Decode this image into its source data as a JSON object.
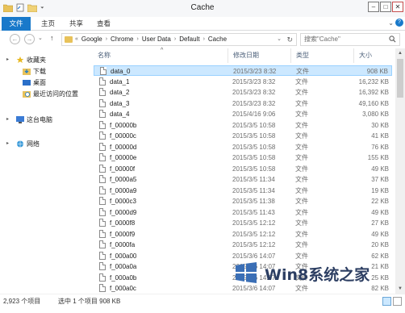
{
  "window": {
    "title": "Cache"
  },
  "ribbon": {
    "tabs": [
      "文件",
      "主页",
      "共享",
      "查看"
    ]
  },
  "nav": {
    "breadcrumb": [
      "Google",
      "Chrome",
      "User Data",
      "Default",
      "Cache"
    ],
    "search_placeholder": "搜索\"Cache\""
  },
  "sidebar": {
    "items": [
      {
        "label": "收藏夹",
        "icon": "favorites-star-icon"
      },
      {
        "label": "下载",
        "icon": "downloads-folder-icon"
      },
      {
        "label": "桌面",
        "icon": "desktop-icon"
      },
      {
        "label": "最近访问的位置",
        "icon": "recent-places-icon"
      },
      {
        "label": "这台电脑",
        "icon": "this-pc-icon"
      },
      {
        "label": "网络",
        "icon": "network-icon"
      }
    ]
  },
  "columns": {
    "name": "名称",
    "date": "修改日期",
    "type": "类型",
    "size": "大小"
  },
  "files": [
    {
      "name": "data_0",
      "date": "2015/3/23 8:32",
      "type": "文件",
      "size": "908 KB",
      "selected": true
    },
    {
      "name": "data_1",
      "date": "2015/3/23 8:32",
      "type": "文件",
      "size": "16,232 KB"
    },
    {
      "name": "data_2",
      "date": "2015/3/23 8:32",
      "type": "文件",
      "size": "16,392 KB"
    },
    {
      "name": "data_3",
      "date": "2015/3/23 8:32",
      "type": "文件",
      "size": "49,160 KB"
    },
    {
      "name": "data_4",
      "date": "2015/4/16 9:06",
      "type": "文件",
      "size": "3,080 KB"
    },
    {
      "name": "f_00000b",
      "date": "2015/3/5 10:58",
      "type": "文件",
      "size": "30 KB"
    },
    {
      "name": "f_00000c",
      "date": "2015/3/5 10:58",
      "type": "文件",
      "size": "41 KB"
    },
    {
      "name": "f_00000d",
      "date": "2015/3/5 10:58",
      "type": "文件",
      "size": "76 KB"
    },
    {
      "name": "f_00000e",
      "date": "2015/3/5 10:58",
      "type": "文件",
      "size": "155 KB"
    },
    {
      "name": "f_00000f",
      "date": "2015/3/5 10:58",
      "type": "文件",
      "size": "49 KB"
    },
    {
      "name": "f_0000a5",
      "date": "2015/3/5 11:34",
      "type": "文件",
      "size": "37 KB"
    },
    {
      "name": "f_0000a9",
      "date": "2015/3/5 11:34",
      "type": "文件",
      "size": "19 KB"
    },
    {
      "name": "f_0000c3",
      "date": "2015/3/5 11:38",
      "type": "文件",
      "size": "22 KB"
    },
    {
      "name": "f_0000d9",
      "date": "2015/3/5 11:43",
      "type": "文件",
      "size": "49 KB"
    },
    {
      "name": "f_0000f8",
      "date": "2015/3/5 12:12",
      "type": "文件",
      "size": "27 KB"
    },
    {
      "name": "f_0000f9",
      "date": "2015/3/5 12:12",
      "type": "文件",
      "size": "49 KB"
    },
    {
      "name": "f_0000fa",
      "date": "2015/3/5 12:12",
      "type": "文件",
      "size": "20 KB"
    },
    {
      "name": "f_000a00",
      "date": "2015/3/6 14:07",
      "type": "文件",
      "size": "62 KB"
    },
    {
      "name": "f_000a0a",
      "date": "2015/3/6 14:07",
      "type": "文件",
      "size": "21 KB"
    },
    {
      "name": "f_000a0b",
      "date": "2015/3/6 14:07",
      "type": "文件",
      "size": "25 KB"
    },
    {
      "name": "f_000a0c",
      "date": "2015/3/6 14:07",
      "type": "文件",
      "size": "82 KB"
    }
  ],
  "status": {
    "count": "2,923 个项目",
    "selection": "选中 1 个项目  908 KB"
  },
  "watermark": {
    "text": "Win8系统之家"
  },
  "colors": {
    "accent": "#1979ca",
    "selection": "#cce8ff"
  }
}
